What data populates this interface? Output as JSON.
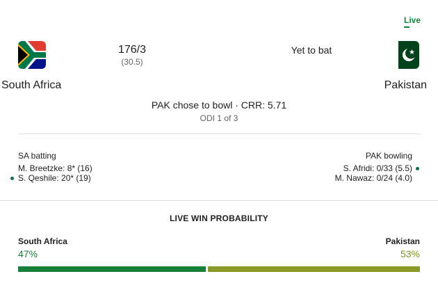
{
  "live_label": "Live",
  "teams": {
    "home": {
      "name": "South Africa",
      "flag_icon": "south-africa-flag-icon",
      "score": "176/3",
      "overs": "(30.5)"
    },
    "away": {
      "name": "Pakistan",
      "flag_icon": "pakistan-flag-icon",
      "status": "Yet to bat"
    }
  },
  "match": {
    "status_line": "PAK chose to bowl · CRR: 5.71",
    "series_info": "ODI 1 of 3"
  },
  "batting": {
    "title": "SA batting",
    "players": [
      {
        "text": "M. Breetzke: 8* (16)",
        "on_strike": false
      },
      {
        "text": "S. Qeshile: 20* (19)",
        "on_strike": true
      }
    ]
  },
  "bowling": {
    "title": "PAK bowling",
    "players": [
      {
        "text": "S. Afridi: 0/33 (5.5)",
        "current": true
      },
      {
        "text": "M. Nawaz: 0/24 (4.0)",
        "current": false
      }
    ]
  },
  "win_probability": {
    "title": "LIVE WIN PROBABILITY",
    "home": {
      "name": "South Africa",
      "pct_label": "47%",
      "value": 47
    },
    "away": {
      "name": "Pakistan",
      "pct_label": "53%",
      "value": 53
    }
  },
  "colors": {
    "live": "#188038",
    "home_bar": "#188038",
    "away_bar": "#8a9a2a",
    "away_pct": "#7f8f1f",
    "indicator_dot": "#0b6e4f"
  }
}
